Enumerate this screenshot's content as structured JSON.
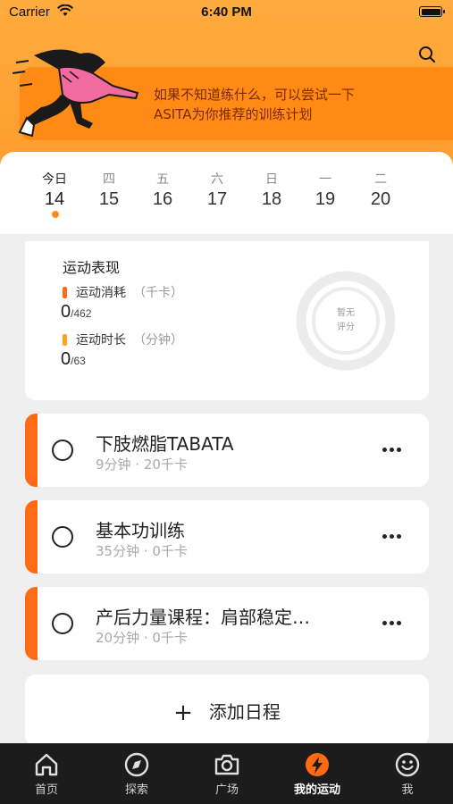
{
  "status_bar": {
    "carrier": "Carrier",
    "time": "6:40 PM"
  },
  "banner": {
    "line1": "如果不知道练什么，可以尝试一下",
    "line2": "ASITA为你推荐的训练计划"
  },
  "calendar": {
    "days": [
      {
        "weekday": "今日",
        "date": "14"
      },
      {
        "weekday": "四",
        "date": "15"
      },
      {
        "weekday": "五",
        "date": "16"
      },
      {
        "weekday": "六",
        "date": "17"
      },
      {
        "weekday": "日",
        "date": "18"
      },
      {
        "weekday": "一",
        "date": "19"
      },
      {
        "weekday": "二",
        "date": "20"
      }
    ]
  },
  "stats": {
    "title": "运动表现",
    "calories": {
      "label": "运动消耗",
      "unit": "（千卡）",
      "value": "0",
      "goal": "/462"
    },
    "duration": {
      "label": "运动时长",
      "unit": "（分钟）",
      "value": "0",
      "goal": "/63"
    },
    "score_line1": "暂无",
    "score_line2": "评分"
  },
  "workouts": [
    {
      "name": "下肢燃脂TABATA",
      "meta": "9分钟 · 20千卡"
    },
    {
      "name": "基本功训练",
      "meta": "35分钟 · 0千卡"
    },
    {
      "name": "产后力量课程：肩部稳定…",
      "meta": "20分钟 · 0千卡"
    }
  ],
  "add_schedule": {
    "plus": "+",
    "label": "添加日程"
  },
  "tabs": [
    {
      "label": "首页",
      "icon": "home-icon"
    },
    {
      "label": "探索",
      "icon": "compass-icon"
    },
    {
      "label": "广场",
      "icon": "camera-icon"
    },
    {
      "label": "我的运动",
      "icon": "lightning-icon"
    },
    {
      "label": "我",
      "icon": "smiley-icon"
    }
  ],
  "colors": {
    "header": "#ffab3e",
    "accent": "#ff6a14",
    "calorie_bar": "#ff6a14",
    "duration_bar": "#ffa21f"
  }
}
